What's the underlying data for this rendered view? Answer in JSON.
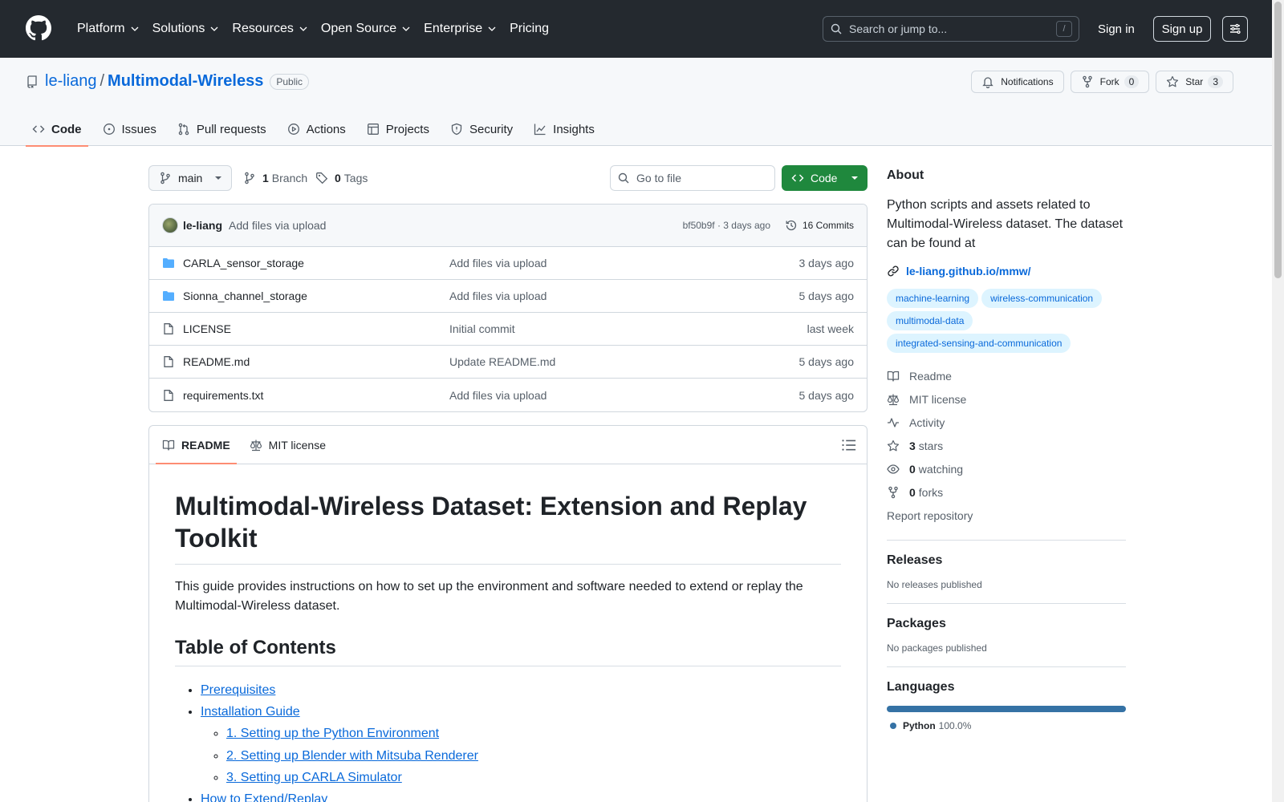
{
  "header": {
    "nav": [
      {
        "label": "Platform",
        "dropdown": true
      },
      {
        "label": "Solutions",
        "dropdown": true
      },
      {
        "label": "Resources",
        "dropdown": true
      },
      {
        "label": "Open Source",
        "dropdown": true
      },
      {
        "label": "Enterprise",
        "dropdown": true
      },
      {
        "label": "Pricing",
        "dropdown": false
      }
    ],
    "search_placeholder": "Search or jump to...",
    "search_shortcut": "/",
    "sign_in": "Sign in",
    "sign_up": "Sign up"
  },
  "repo": {
    "owner": "le-liang",
    "separator": "/",
    "name": "Multimodal-Wireless",
    "visibility": "Public",
    "notifications_label": "Notifications",
    "fork_label": "Fork",
    "fork_count": "0",
    "star_label": "Star",
    "star_count": "3",
    "tabs": [
      {
        "label": "Code",
        "icon": "code-icon",
        "active": true
      },
      {
        "label": "Issues",
        "icon": "issue-icon",
        "active": false
      },
      {
        "label": "Pull requests",
        "icon": "pull-request-icon",
        "active": false
      },
      {
        "label": "Actions",
        "icon": "play-icon",
        "active": false
      },
      {
        "label": "Projects",
        "icon": "table-icon",
        "active": false
      },
      {
        "label": "Security",
        "icon": "shield-icon",
        "active": false
      },
      {
        "label": "Insights",
        "icon": "graph-icon",
        "active": false
      }
    ]
  },
  "toolbar": {
    "branch": "main",
    "branch_count": "1",
    "branch_label": "Branch",
    "tag_count": "0",
    "tag_label": "Tags",
    "goto_placeholder": "Go to file",
    "code_button": "Code"
  },
  "latest_commit": {
    "author": "le-liang",
    "message": "Add files via upload",
    "meta": "bf50b9f · 3 days ago",
    "commits": "16 Commits"
  },
  "files": [
    {
      "name": "CARLA_sensor_storage",
      "type": "folder",
      "commit": "Add files via upload",
      "age": "3 days ago"
    },
    {
      "name": "Sionna_channel_storage",
      "type": "folder",
      "commit": "Add files via upload",
      "age": "5 days ago"
    },
    {
      "name": "LICENSE",
      "type": "file",
      "commit": "Initial commit",
      "age": "last week"
    },
    {
      "name": "README.md",
      "type": "file",
      "commit": "Update README.md",
      "age": "5 days ago"
    },
    {
      "name": "requirements.txt",
      "type": "file",
      "commit": "Add files via upload",
      "age": "5 days ago"
    }
  ],
  "readme": {
    "tab_readme": "README",
    "tab_license": "MIT license",
    "title": "Multimodal-Wireless Dataset: Extension and Replay Toolkit",
    "intro": "This guide provides instructions on how to set up the environment and software needed to extend or replay the Multimodal-Wireless dataset.",
    "toc_heading": "Table of Contents",
    "toc": {
      "prerequisites": "Prerequisites",
      "installation": "Installation Guide",
      "installation_items": [
        "1. Setting up the Python Environment",
        "2. Setting up Blender with Mitsuba Renderer",
        "3. Setting up CARLA Simulator"
      ],
      "extend": "How to Extend/Replay"
    }
  },
  "about": {
    "heading": "About",
    "description": "Python scripts and assets related to Multimodal-Wireless dataset. The dataset can be found at",
    "link": "le-liang.github.io/mmw/",
    "topics": [
      "machine-learning",
      "wireless-communication",
      "multimodal-data",
      "integrated-sensing-and-communication"
    ],
    "readme": "Readme",
    "license": "MIT license",
    "activity": "Activity",
    "stars_count": "3",
    "stars_label": "stars",
    "watching_count": "0",
    "watching_label": "watching",
    "forks_count": "0",
    "forks_label": "forks",
    "report": "Report repository"
  },
  "releases": {
    "heading": "Releases",
    "text": "No releases published"
  },
  "packages": {
    "heading": "Packages",
    "text": "No packages published"
  },
  "languages": {
    "heading": "Languages",
    "items": [
      {
        "name": "Python",
        "percent": "100.0%",
        "color": "#3572A5",
        "share": 100
      }
    ]
  }
}
